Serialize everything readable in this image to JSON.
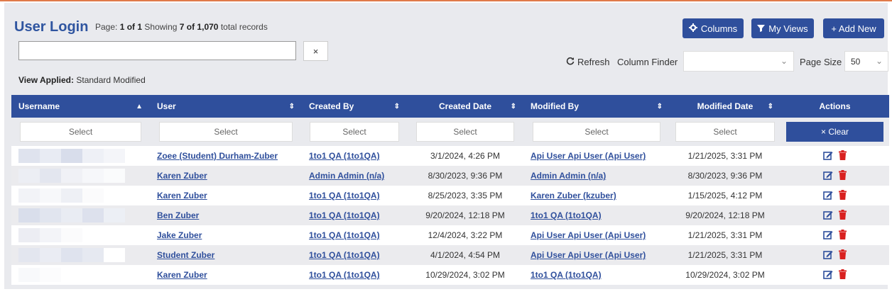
{
  "header": {
    "title": "User Login",
    "page_label": "Page:",
    "page": "1 of 1",
    "showing_label": "Showing",
    "showing": "7 of 1,070",
    "total_label": "total records"
  },
  "toolbar": {
    "columns_label": "Columns",
    "my_views_label": "My Views",
    "add_new_label": "+ Add New",
    "search_value": "",
    "search_clear": "×",
    "refresh_label": "Refresh",
    "column_finder_label": "Column Finder",
    "page_size_label": "Page Size",
    "page_size_value": "50"
  },
  "view_applied": {
    "label": "View Applied:",
    "value": "Standard Modified"
  },
  "columns": [
    {
      "label": "Username",
      "sort": "asc"
    },
    {
      "label": "User",
      "sort": "both"
    },
    {
      "label": "Created By",
      "sort": "both"
    },
    {
      "label": "Created Date",
      "sort": "both"
    },
    {
      "label": "Modified By",
      "sort": "both"
    },
    {
      "label": "Modified Date",
      "sort": "both"
    },
    {
      "label": "Actions",
      "sort": "none"
    }
  ],
  "filters": {
    "placeholder": "Select",
    "clear_label": "× Clear"
  },
  "rows": [
    {
      "user": "Zoee (Student) Durham-Zuber",
      "created_by": "1to1 QA (1to1QA)",
      "created_date": "3/1/2024, 4:26 PM",
      "modified_by": "Api User Api User (Api User)",
      "modified_date": "1/21/2025, 3:31 PM"
    },
    {
      "user": "Karen Zuber",
      "created_by": "Admin Admin (n/a)",
      "created_date": "8/30/2023, 9:36 PM",
      "modified_by": "Admin Admin (n/a)",
      "modified_date": "8/30/2023, 9:36 PM"
    },
    {
      "user": "Karen Zuber",
      "created_by": "1to1 QA (1to1QA)",
      "created_date": "8/25/2023, 3:35 PM",
      "modified_by": "Karen Zuber (kzuber)",
      "modified_date": "1/15/2025, 4:12 PM"
    },
    {
      "user": "Ben Zuber",
      "created_by": "1to1 QA (1to1QA)",
      "created_date": "9/20/2024, 12:18 PM",
      "modified_by": "1to1 QA (1to1QA)",
      "modified_date": "9/20/2024, 12:18 PM"
    },
    {
      "user": "Jake Zuber",
      "created_by": "1to1 QA (1to1QA)",
      "created_date": "12/4/2024, 3:22 PM",
      "modified_by": "Api User Api User (Api User)",
      "modified_date": "1/21/2025, 3:31 PM"
    },
    {
      "user": "Student Zuber",
      "created_by": "1to1 QA (1to1QA)",
      "created_date": "4/1/2024, 4:54 PM",
      "modified_by": "Api User Api User (Api User)",
      "modified_date": "1/21/2025, 3:31 PM"
    },
    {
      "user": "Karen Zuber",
      "created_by": "1to1 QA (1to1QA)",
      "created_date": "10/29/2024, 3:02 PM",
      "modified_by": "1to1 QA (1to1QA)",
      "modified_date": "10/29/2024, 3:02 PM"
    }
  ],
  "icons": {
    "edit": "edit-icon",
    "delete": "trash-icon",
    "columns": "gear-icon",
    "views": "filter-icon",
    "refresh": "refresh-icon"
  },
  "colors": {
    "accent": "#2f4f9c",
    "title": "#2f55a0",
    "delete": "#d9201f",
    "header_strip": "#e07a4a"
  }
}
